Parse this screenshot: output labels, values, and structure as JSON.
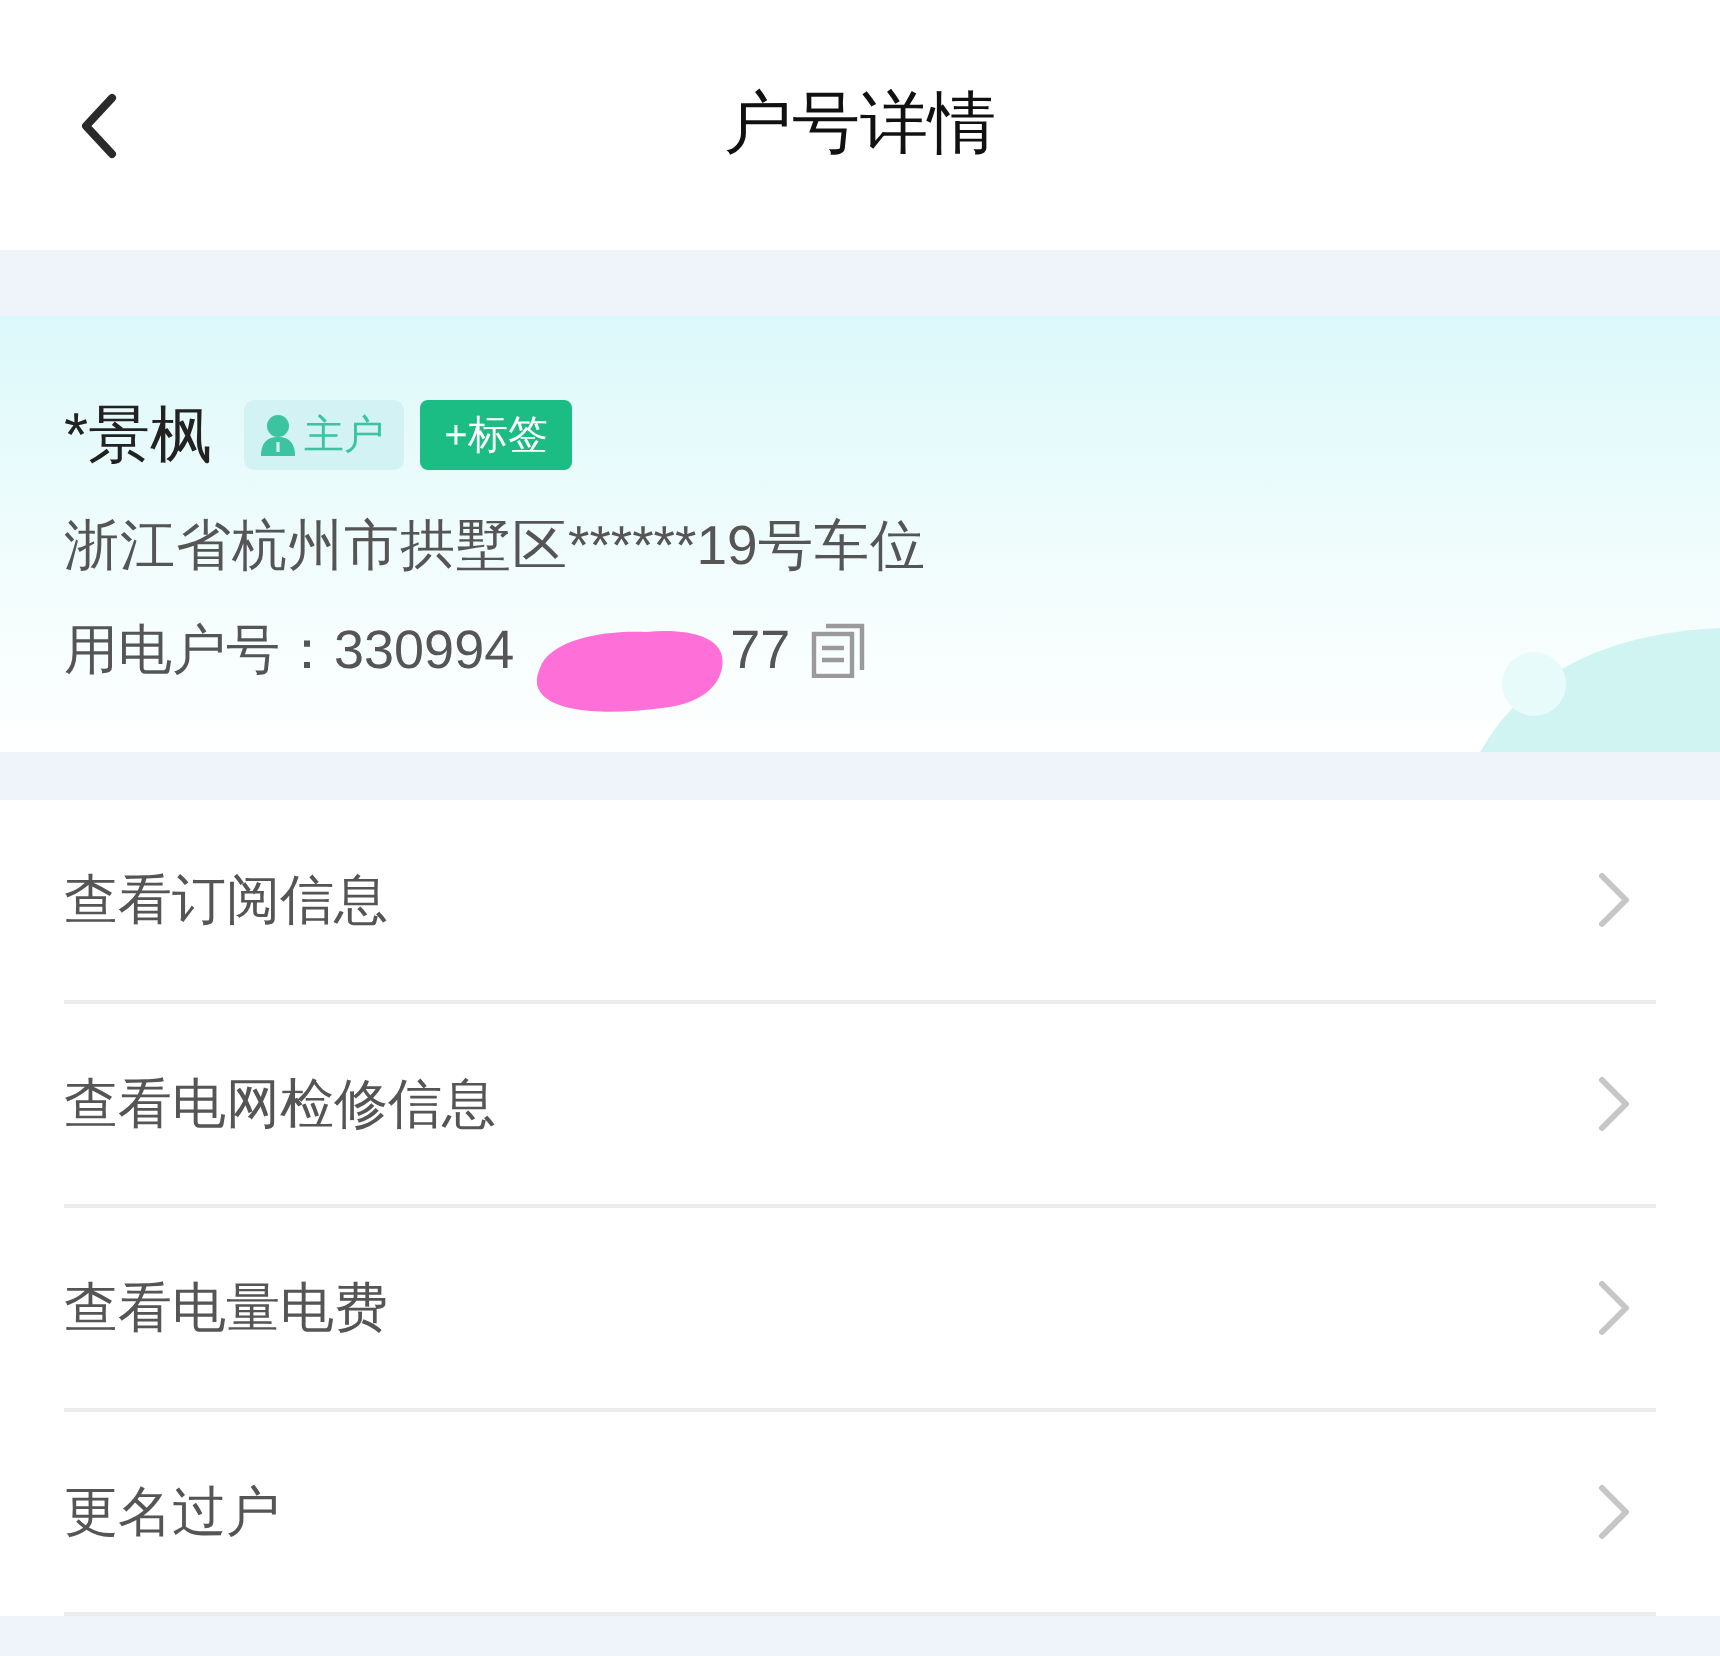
{
  "header": {
    "title": "户号详情"
  },
  "account": {
    "name": "*景枫",
    "role_badge": "主户",
    "tag_button": "+标签",
    "address": "浙江省杭州市拱墅区******19号车位",
    "account_label": "用电户号：",
    "account_number_start": "330994",
    "account_number_end": "77"
  },
  "menu": [
    {
      "label": "查看订阅信息"
    },
    {
      "label": "查看电网检修信息"
    },
    {
      "label": "查看电量电费"
    },
    {
      "label": "更名过户"
    }
  ]
}
